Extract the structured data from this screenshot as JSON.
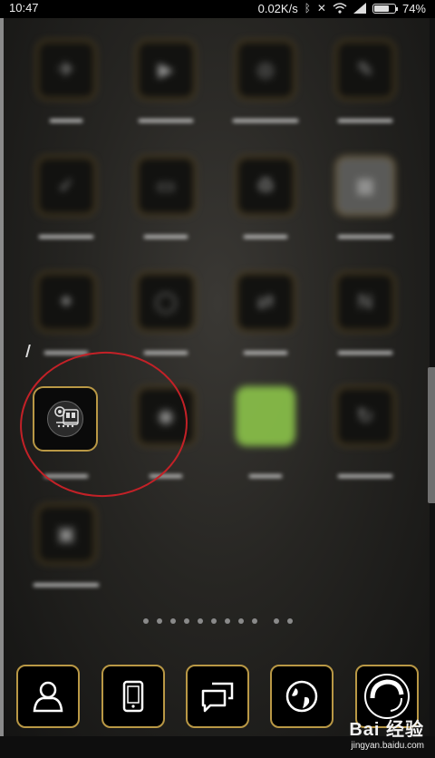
{
  "status_bar": {
    "time": "10:47",
    "network_speed": "0.02K/s",
    "battery_percent_label": "74%",
    "battery_level": 0.74,
    "icons": [
      "bluetooth-icon",
      "mute-icon",
      "wifi-icon",
      "signal-icon",
      "battery-icon"
    ]
  },
  "home_screen": {
    "highlight_ring_color": "#c32127",
    "tile_border_color": "#b99845",
    "apps": []
  },
  "page_indicator": {
    "dots_count": 12,
    "current_index": 9
  },
  "dock": {
    "items": [
      {
        "icon": "contacts-icon"
      },
      {
        "icon": "phone-icon"
      },
      {
        "icon": "messages-icon"
      },
      {
        "icon": "browser-icon"
      },
      {
        "icon": "camera-icon"
      }
    ]
  },
  "watermark": {
    "logo": "Bai 经验",
    "url": "jingyan.baidu.com"
  }
}
